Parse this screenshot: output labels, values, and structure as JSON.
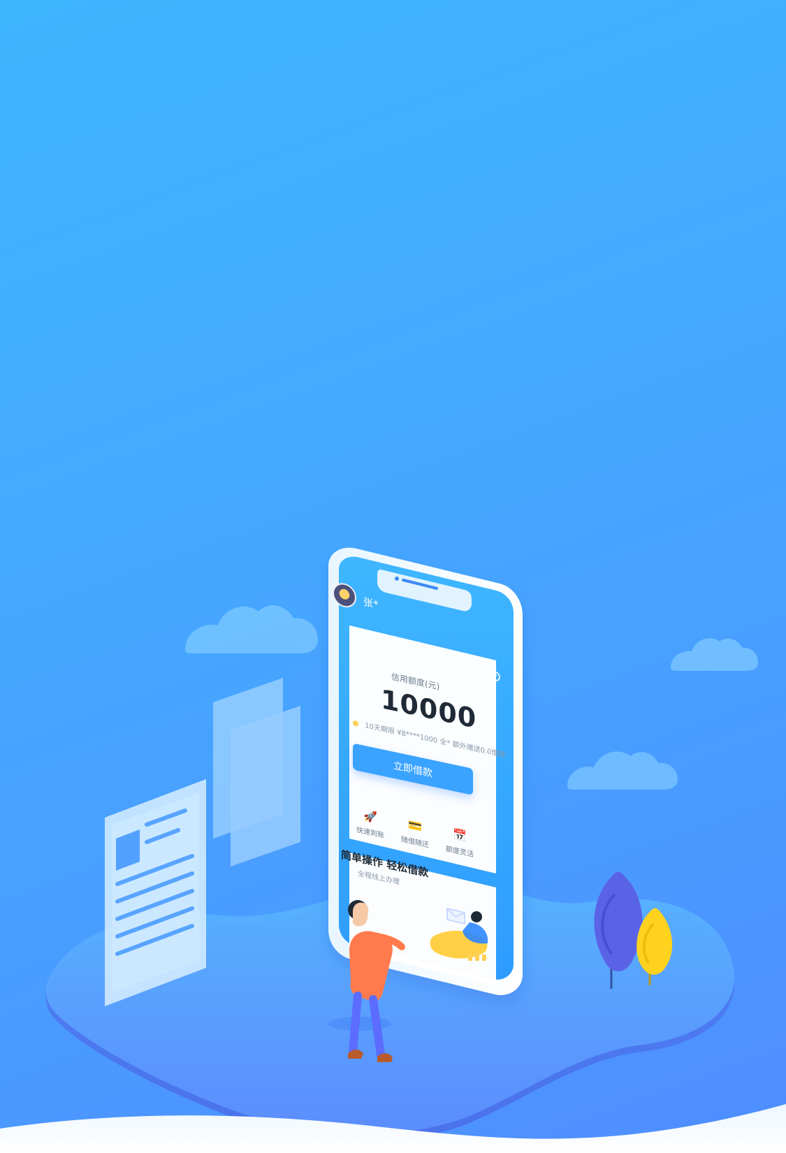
{
  "phone": {
    "user_name": "张*",
    "credit": {
      "label": "信用额度(元)",
      "value": "10000",
      "info_line": "10天期限  ¥8****1000 全*  额外赠送0.0借款"
    },
    "borrow_button": "立即借款",
    "features": [
      {
        "label": "快速到账",
        "icon": "rocket-icon"
      },
      {
        "label": "随借随还",
        "icon": "card-icon"
      },
      {
        "label": "额度灵活",
        "icon": "calendar-icon"
      }
    ],
    "banner": {
      "title": "简单操作 轻松借款",
      "subtitle": "全程线上办理"
    }
  },
  "colors": {
    "bg_top": "#3fb4ff",
    "bg_bottom": "#4f8dff",
    "accent": "#3aa3ff",
    "card": "#ffffff",
    "tree_purple": "#5a63e6",
    "tree_yellow": "#ffd21e",
    "person_shirt": "#ff7a4c",
    "person_pants": "#5b6cff"
  }
}
